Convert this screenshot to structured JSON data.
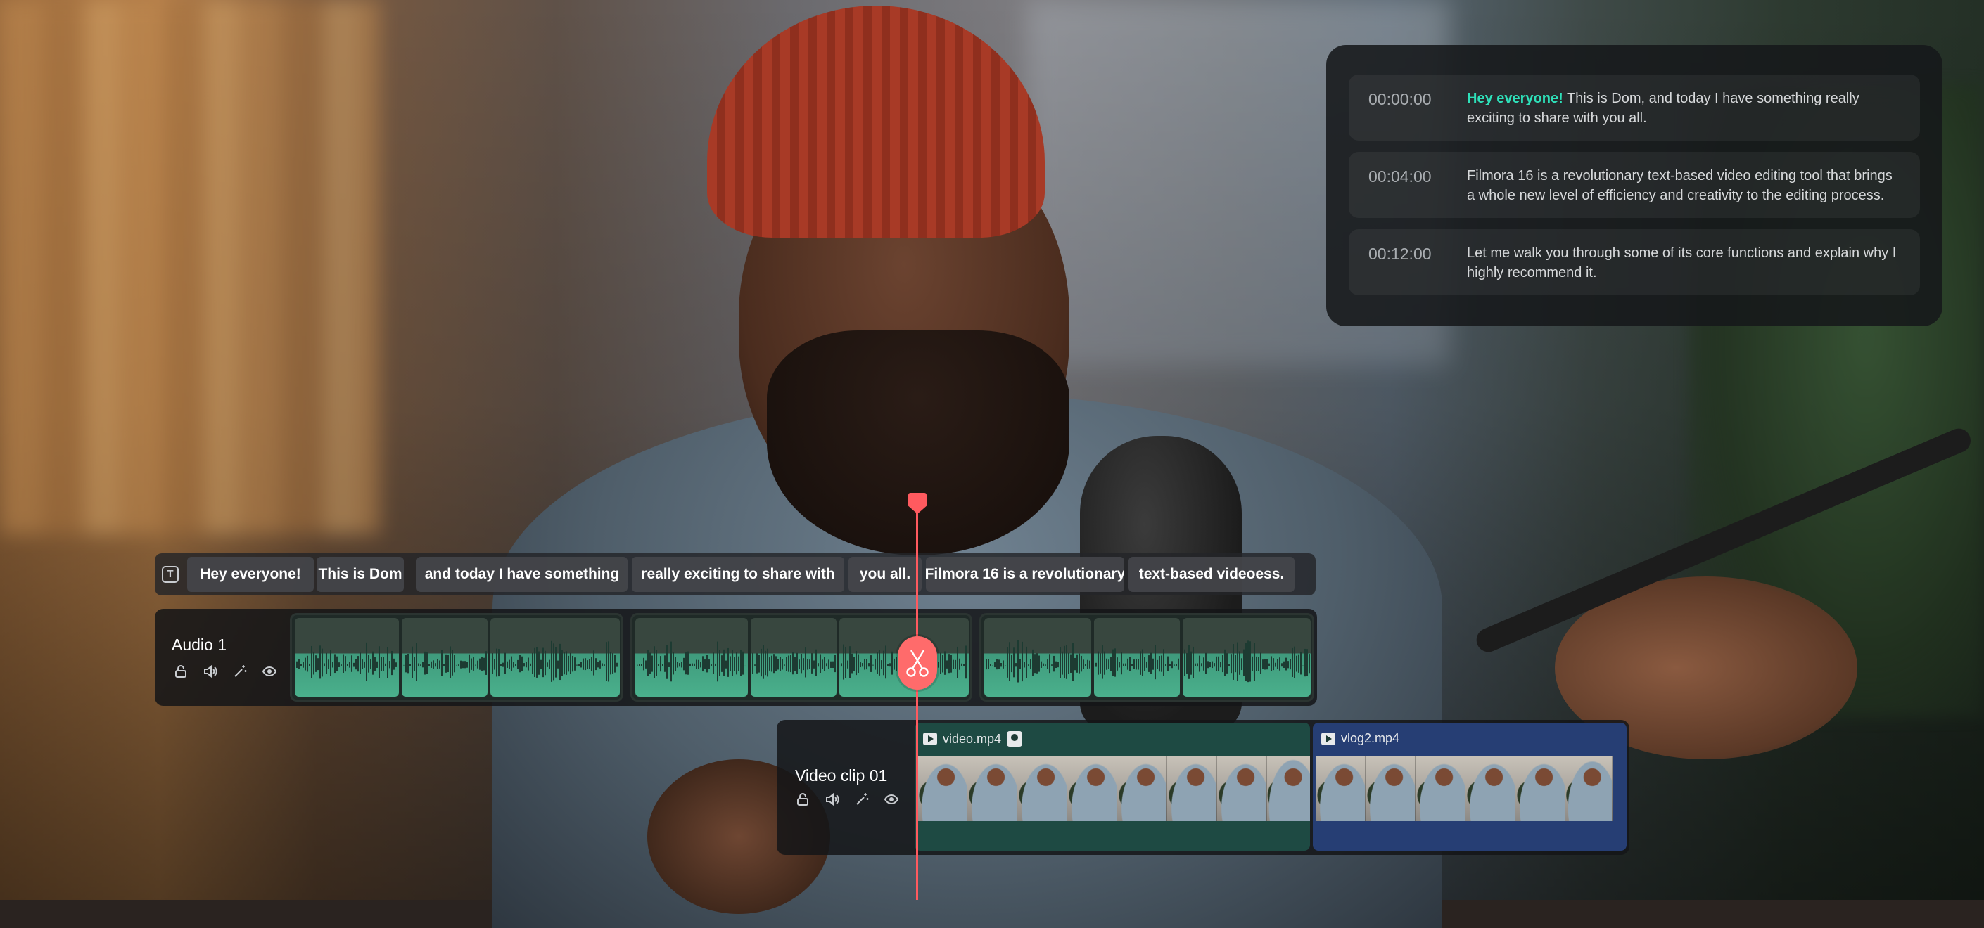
{
  "transcript": [
    {
      "time": "00:00:00",
      "highlight": "Hey everyone!",
      "text": " This is Dom, and today I have something really exciting to share with you all."
    },
    {
      "time": "00:04:00",
      "highlight": "",
      "text": "Filmora 16 is a revolutionary text-based video editing tool that brings a whole new level of efficiency and creativity to the editing process."
    },
    {
      "time": "00:12:00",
      "highlight": "",
      "text": "Let me walk you through some of its core functions and explain why I highly recommend it."
    }
  ],
  "captions": [
    "Hey everyone!",
    "This is Dom",
    "and today I have something",
    "really exciting to share with",
    "you all.",
    "Filmora 16 is a revolutionary",
    "text-based videoess."
  ],
  "audio_track": {
    "title": "Audio 1",
    "icons": [
      "lock-icon",
      "speaker-icon",
      "magic-wand-icon",
      "eye-icon"
    ]
  },
  "video_track": {
    "title": "Video clip 01",
    "clips": [
      {
        "name": "video.mp4",
        "color": "#1e4a43"
      },
      {
        "name": "vlog2.mp4",
        "color": "#263e74"
      }
    ]
  },
  "colors": {
    "highlight": "#2ee0b9",
    "playhead": "#ff5a5f",
    "audio_wave": "#4ab08c"
  }
}
